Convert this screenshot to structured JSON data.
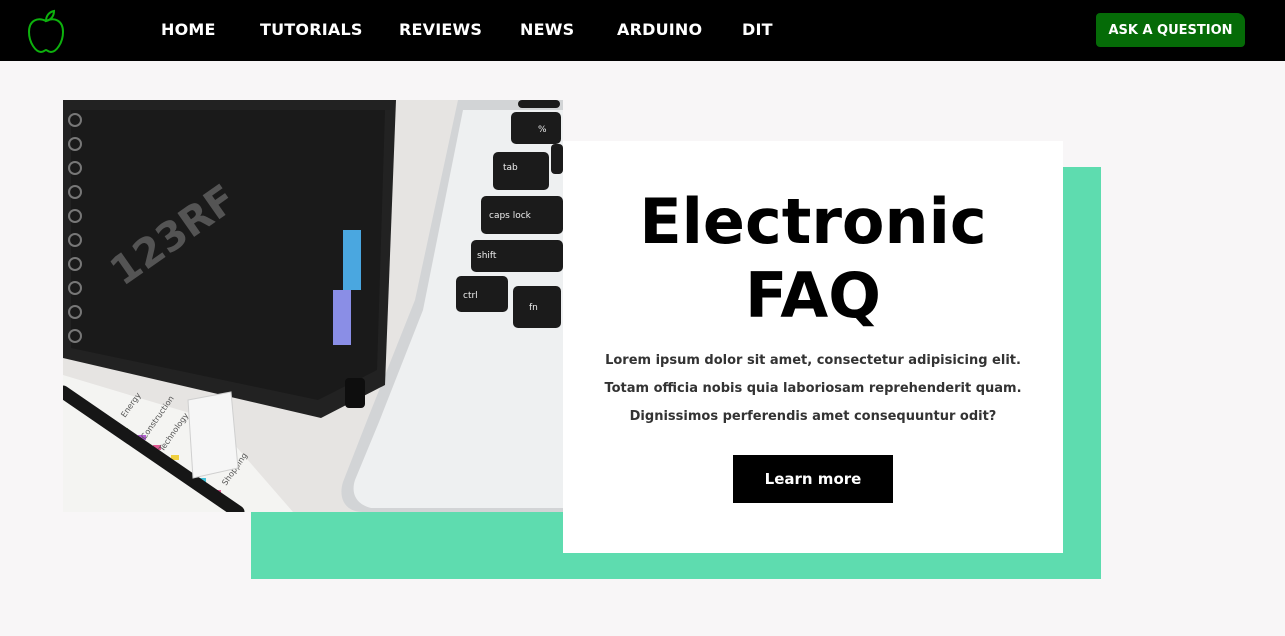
{
  "nav": {
    "logo_icon": "apple-logo-icon",
    "links": [
      "HOME",
      "TUTORIALS",
      "REVIEWS",
      "NEWS",
      "ARDUINO",
      "DIT"
    ],
    "cta": "ASK A QUESTION"
  },
  "hero": {
    "title_line1": "Electronic",
    "title_line2": "FAQ",
    "description": "Lorem ipsum dolor sit amet, consectetur adipisicing elit. Totam officia nobis quia laboriosam reprehenderit quam. Dignissimos perferendis amet consequuntur odit?",
    "button_label": "Learn more",
    "image_watermark": "123RF",
    "keyboard_keys": [
      "%",
      "tab",
      "caps lock",
      "shift",
      "ctrl",
      "fn"
    ],
    "sticky_labels": [
      "Energy",
      "Construction",
      "Technology",
      "Shopping"
    ]
  },
  "colors": {
    "navbar_bg": "#000000",
    "cta_bg": "#056b07",
    "accent_block": "#5edcaf",
    "page_bg": "#f8f6f7"
  }
}
